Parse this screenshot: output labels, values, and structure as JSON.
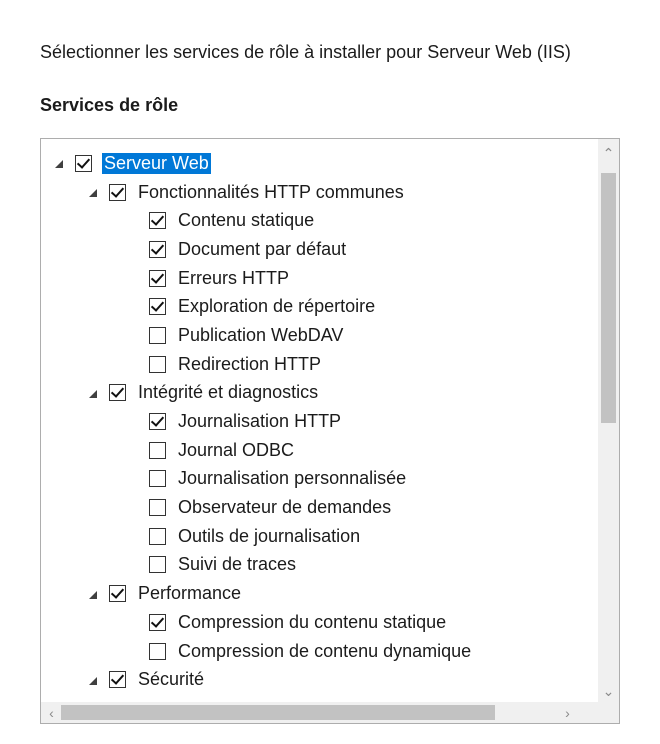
{
  "header": {
    "intro": "Sélectionner les services de rôle à installer pour Serveur Web (IIS)",
    "section_title": "Services de rôle"
  },
  "tree": [
    {
      "label": "Serveur Web",
      "level": 0,
      "checked": true,
      "expander": true,
      "selected": true
    },
    {
      "label": "Fonctionnalités HTTP communes",
      "level": 1,
      "checked": true,
      "expander": true
    },
    {
      "label": "Contenu statique",
      "level": 2,
      "checked": true
    },
    {
      "label": "Document par défaut",
      "level": 2,
      "checked": true
    },
    {
      "label": "Erreurs HTTP",
      "level": 2,
      "checked": true
    },
    {
      "label": "Exploration de répertoire",
      "level": 2,
      "checked": true
    },
    {
      "label": "Publication WebDAV",
      "level": 2,
      "checked": false
    },
    {
      "label": "Redirection HTTP",
      "level": 2,
      "checked": false
    },
    {
      "label": "Intégrité et diagnostics",
      "level": 1,
      "checked": true,
      "expander": true
    },
    {
      "label": "Journalisation HTTP",
      "level": 2,
      "checked": true
    },
    {
      "label": "Journal ODBC",
      "level": 2,
      "checked": false
    },
    {
      "label": "Journalisation personnalisée",
      "level": 2,
      "checked": false
    },
    {
      "label": "Observateur de demandes",
      "level": 2,
      "checked": false
    },
    {
      "label": "Outils de journalisation",
      "level": 2,
      "checked": false
    },
    {
      "label": "Suivi de traces",
      "level": 2,
      "checked": false
    },
    {
      "label": "Performance",
      "level": 1,
      "checked": true,
      "expander": true
    },
    {
      "label": "Compression du contenu statique",
      "level": 2,
      "checked": true
    },
    {
      "label": "Compression de contenu dynamique",
      "level": 2,
      "checked": false
    },
    {
      "label": "Sécurité",
      "level": 1,
      "checked": true,
      "expander": true
    }
  ],
  "scrollbars": {
    "up_icon": "chevron-up-icon",
    "down_icon": "chevron-down-icon",
    "left_icon": "chevron-left-icon",
    "right_icon": "chevron-right-icon"
  },
  "colors": {
    "selection": "#0078d7",
    "border": "#adadad",
    "scrollbar_track": "#f0f0f0",
    "scrollbar_thumb": "#c2c2c2"
  }
}
